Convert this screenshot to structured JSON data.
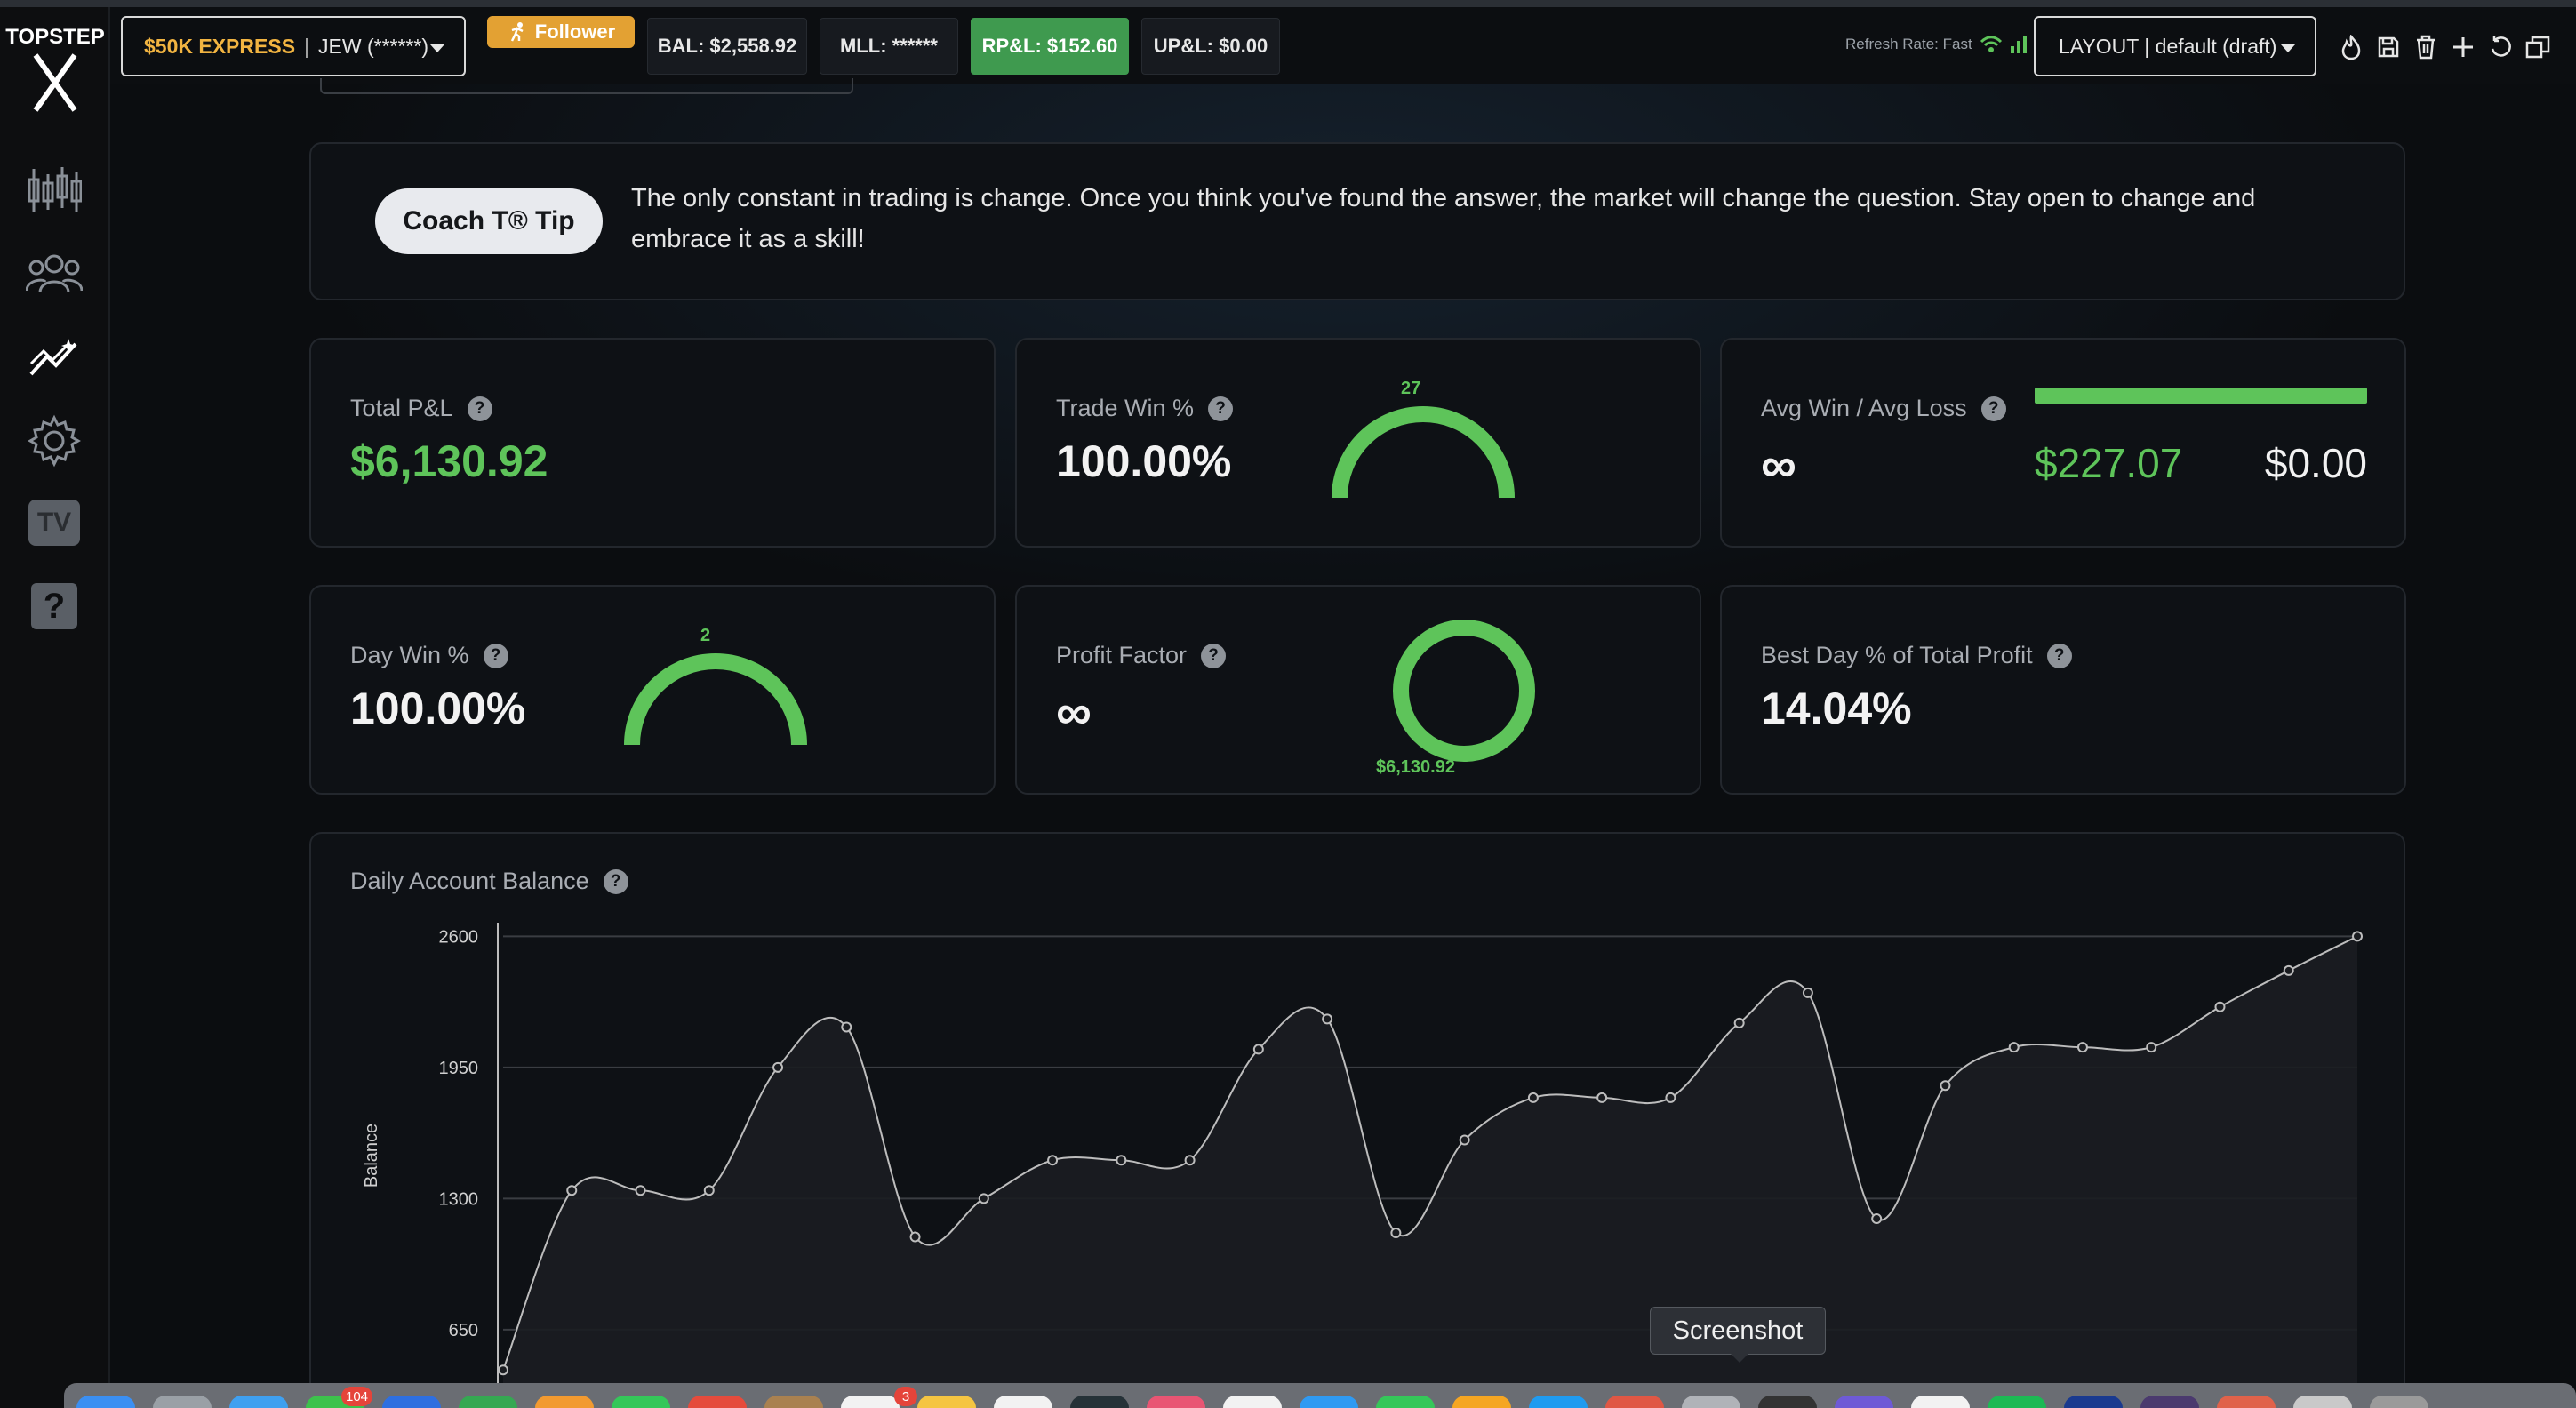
{
  "app": {
    "logo_text": "TOPSTEP"
  },
  "header": {
    "account_type": "$50K EXPRESS",
    "account_name": "JEW (******)",
    "follower_label": "Follower",
    "balance": "BAL: $2,558.92",
    "mll": "MLL: ******",
    "rpnl": "RP&L: $152.60",
    "upnl": "UP&L: $0.00",
    "refresh_rate": "Refresh Rate: Fast",
    "layout": "LAYOUT | default (draft)"
  },
  "sidebar": {
    "items": [
      "chart-icon",
      "users-icon",
      "analytics-icon",
      "settings-icon",
      "tv-icon",
      "help-icon"
    ],
    "tv_label": "TV",
    "help_label": "?"
  },
  "tip": {
    "button": "Coach T® Tip",
    "text": "The only constant in trading is change. Once you think you've found the answer, the market will change the question. Stay open to change and embrace it as a skill!"
  },
  "stats": {
    "total_pnl": {
      "label": "Total P&L",
      "value": "$6,130.92"
    },
    "trade_win": {
      "label": "Trade Win %",
      "value": "100.00%",
      "gauge_count": "27",
      "gauge_fraction": 1.0
    },
    "avg_win_loss": {
      "label": "Avg Win / Avg Loss",
      "value": "∞",
      "avg_win": "$227.07",
      "avg_loss": "$0.00",
      "win_fraction": 1.0
    },
    "day_win": {
      "label": "Day Win %",
      "value": "100.00%",
      "gauge_count": "2",
      "gauge_fraction": 1.0
    },
    "profit_factor": {
      "label": "Profit Factor",
      "value": "∞",
      "donut_amount": "$6,130.92"
    },
    "best_day": {
      "label": "Best Day % of Total Profit",
      "value": "14.04%"
    }
  },
  "help_glyph": "?",
  "chart_data": {
    "type": "area",
    "title": "Daily Account Balance",
    "ylabel": "Balance",
    "xlabel": "",
    "yticks": [
      650,
      1300,
      1950,
      2600
    ],
    "ylim": [
      200,
      2650
    ],
    "values": [
      450,
      1340,
      1340,
      1340,
      1950,
      2150,
      1110,
      1300,
      1490,
      1490,
      1490,
      2040,
      2190,
      1130,
      1590,
      1800,
      1800,
      1800,
      2170,
      2320,
      1200,
      1860,
      2050,
      2050,
      2050,
      2250,
      2430,
      2600
    ],
    "grid": true,
    "colors": {
      "line": "#bdbdbd",
      "fill": "#1b1d21"
    }
  },
  "tooltip": {
    "text": "Screenshot"
  },
  "dock": {
    "badges": [
      "104",
      "3"
    ]
  },
  "colors": {
    "accent_green": "#5ec45a",
    "express_gold": "#f2b441",
    "follower_orange": "#e3a133"
  }
}
